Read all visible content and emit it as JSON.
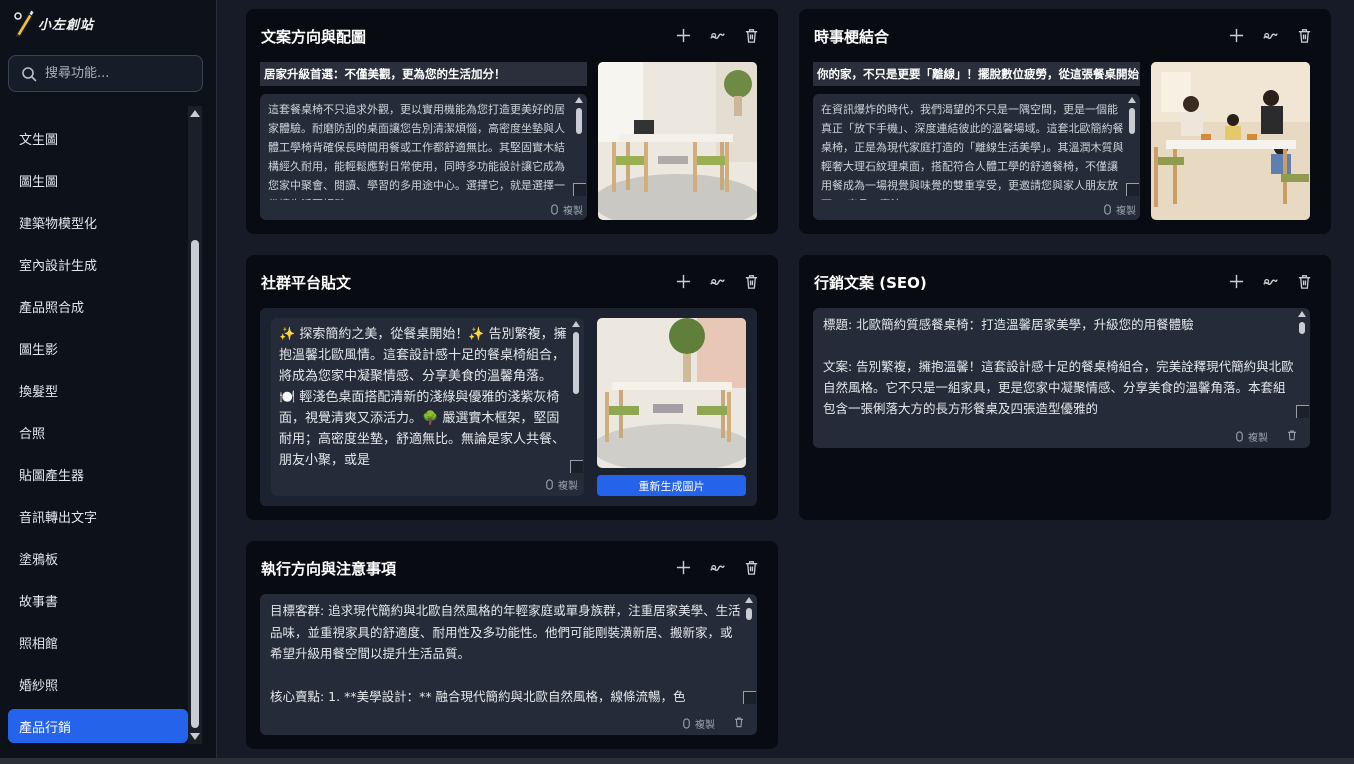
{
  "app": {
    "brand": "小左創站"
  },
  "search": {
    "placeholder": "搜尋功能..."
  },
  "sidebar": {
    "items": [
      {
        "label": "文生圖"
      },
      {
        "label": "圖生圖"
      },
      {
        "label": "建築物模型化"
      },
      {
        "label": "室內設計生成"
      },
      {
        "label": "產品照合成"
      },
      {
        "label": "圖生影"
      },
      {
        "label": "換髮型"
      },
      {
        "label": "合照"
      },
      {
        "label": "貼圖產生器"
      },
      {
        "label": "音訊轉出文字"
      },
      {
        "label": "塗鴉板"
      },
      {
        "label": "故事書"
      },
      {
        "label": "照相館"
      },
      {
        "label": "婚紗照"
      },
      {
        "label": "產品行銷",
        "active": true
      }
    ]
  },
  "cards": {
    "copy_image": {
      "title": "文案方向與配圖",
      "headline": "居家升級首選：不僅美觀，更為您的生活加分！",
      "body": "這套餐桌椅不只追求外觀，更以實用機能為您打造更美好的居家體驗。耐磨防刮的桌面讓您告別清潔煩惱，高密度坐墊與人體工學椅背確保長時間用餐或工作都舒適無比。其堅固實木結構經久耐用，能輕鬆應對日常使用，同時多功能設計讓它成為您家中聚會、閱讀、學習的多用途中心。選擇它，就是選擇一份讓生活更輕鬆、",
      "copy_label": "複製"
    },
    "current_events": {
      "title": "時事梗結合",
      "headline": "你的家，不只是更要「離線」！擺脫數位疲勞，從這張餐桌開始",
      "body": "在資訊爆炸的時代，我們渴望的不只是一隅空間，更是一個能真正「放下手機」、深度連結彼此的溫馨場域。這套北歐簡約餐桌椅，正是為現代家庭打造的「離線生活美學」。其溫潤木質與輕奢大理石紋理桌面，搭配符合人體工學的舒適餐椅，不僅讓用餐成為一場視覺與味覺的雙重享受，更邀請您與家人朋友放下3C產品，專注",
      "copy_label": "複製"
    },
    "social_post": {
      "title": "社群平台貼文",
      "body": "✨ 探索簡約之美，從餐桌開始！✨ 告別繁複，擁抱溫馨北歐風情。這套設計感十足的餐桌椅組合，將成為您家中凝聚情感、分享美食的溫馨角落。🍽️ 輕淺色桌面搭配清新的淺綠與優雅的淺紫灰椅面，視覺清爽又添活力。🌳 嚴選實木框架，堅固耐用；高密度坐墊，舒適無比。無論是家人共餐、朋友小聚，或是",
      "copy_label": "複製",
      "regen_label": "重新生成圖片"
    },
    "seo": {
      "title": "行銷文案 (SEO)",
      "body": "標題: 北歐簡約質感餐桌椅：打造溫馨居家美學，升級您的用餐體驗\n\n文案: 告別繁複，擁抱溫馨！這套設計感十足的餐桌椅組合，完美詮釋現代簡約與北歐自然風格。它不只是一組家具，更是您家中凝聚情感、分享美食的溫馨角落。本套組包含一張俐落大方的長方形餐桌及四張造型優雅的",
      "copy_label": "複製"
    },
    "execution": {
      "title": "執行方向與注意事項",
      "body": "目標客群: 追求現代簡約與北歐自然風格的年輕家庭或單身族群，注重居家美學、生活品味，並重視家具的舒適度、耐用性及多功能性。他們可能剛裝潢新居、搬新家，或希望升級用餐空間以提升生活品質。\n\n核心賣點: 1. **美學設計：** 融合現代簡約與北歐自然風格，線條流暢，色",
      "copy_label": "複製"
    }
  },
  "colors": {
    "accent": "#2563eb",
    "card_bg": "#080b12",
    "page_bg": "#161b27",
    "sidebar_bg": "#0d1119"
  }
}
